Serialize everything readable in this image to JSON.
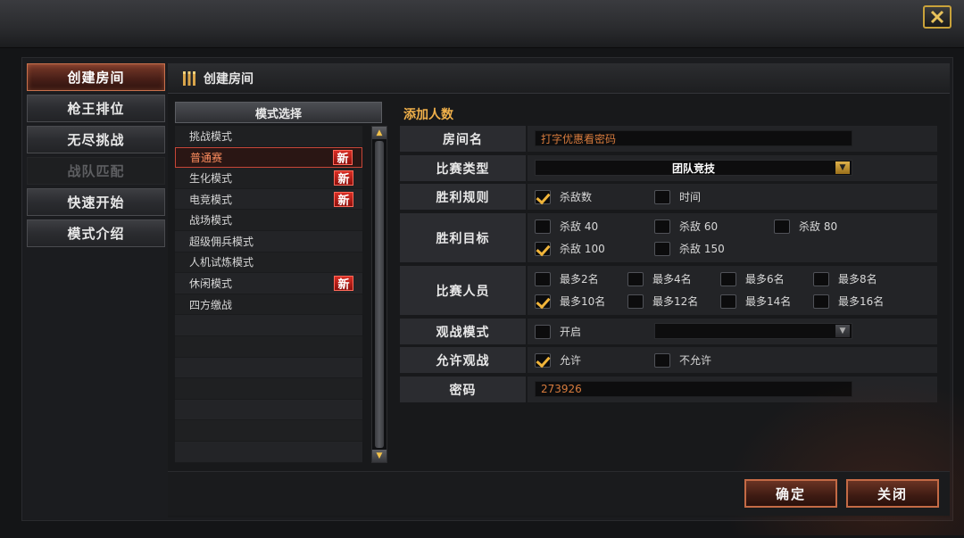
{
  "close_icon": "close-x-icon",
  "menu": [
    {
      "label": "创建房间",
      "state": "active"
    },
    {
      "label": "枪王排位",
      "state": "normal"
    },
    {
      "label": "无尽挑战",
      "state": "normal"
    },
    {
      "label": "战队匹配",
      "state": "disabled"
    },
    {
      "label": "快速开始",
      "state": "normal"
    },
    {
      "label": "模式介绍",
      "state": "normal"
    }
  ],
  "header": {
    "title": "创建房间",
    "icon": "bullets-icon"
  },
  "mode_panel": {
    "title": "模式选择",
    "items": [
      {
        "label": "挑战模式",
        "new": ""
      },
      {
        "label": "普通赛",
        "new": "新"
      },
      {
        "label": "生化模式",
        "new": "新"
      },
      {
        "label": "电竞模式",
        "new": "新"
      },
      {
        "label": "战场模式",
        "new": ""
      },
      {
        "label": "超级佣兵模式",
        "new": ""
      },
      {
        "label": "人机试炼模式",
        "new": ""
      },
      {
        "label": "休闲模式",
        "new": "新"
      },
      {
        "label": "四方缴战",
        "new": ""
      }
    ],
    "selected_index": 1
  },
  "settings": {
    "section_title": "添加人数",
    "room_name": {
      "label": "房间名",
      "value": "打字优惠看密码"
    },
    "match_type": {
      "label": "比赛类型",
      "value": "团队竞技"
    },
    "win_rule": {
      "label": "胜利规则",
      "options": [
        {
          "text": "杀敌数",
          "checked": true
        },
        {
          "text": "时间",
          "checked": false
        }
      ]
    },
    "win_target": {
      "label": "胜利目标",
      "options": [
        {
          "text": "杀敌 40",
          "checked": false
        },
        {
          "text": "杀敌 60",
          "checked": false
        },
        {
          "text": "杀敌 80",
          "checked": false
        },
        {
          "text": "杀敌 100",
          "checked": true
        },
        {
          "text": "杀敌 150",
          "checked": false
        }
      ]
    },
    "players": {
      "label": "比赛人员",
      "options": [
        {
          "text": "最多2名",
          "checked": false
        },
        {
          "text": "最多4名",
          "checked": false
        },
        {
          "text": "最多6名",
          "checked": false
        },
        {
          "text": "最多8名",
          "checked": false
        },
        {
          "text": "最多10名",
          "checked": true
        },
        {
          "text": "最多12名",
          "checked": false
        },
        {
          "text": "最多14名",
          "checked": false
        },
        {
          "text": "最多16名",
          "checked": false
        }
      ]
    },
    "spectate_mode": {
      "label": "观战模式",
      "option": {
        "text": "开启",
        "checked": false
      }
    },
    "allow_spectate": {
      "label": "允许观战",
      "options": [
        {
          "text": "允许",
          "checked": true
        },
        {
          "text": "不允许",
          "checked": false
        }
      ]
    },
    "password": {
      "label": "密码",
      "value": "273926"
    }
  },
  "buttons": {
    "confirm": "确定",
    "close": "关闭"
  },
  "colors": {
    "accent": "#f0b04a",
    "selected": "#c74638",
    "badge": "#d92e25"
  }
}
